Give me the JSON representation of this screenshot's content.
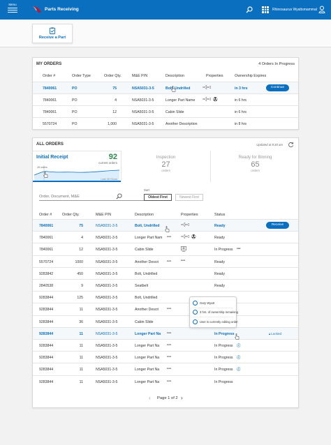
{
  "header": {
    "menu_label": "Menu",
    "app_title": "Parts Receiving",
    "user_name": "Rhinosaurus Wyattsmammal",
    "brand_color": "#0b6fbf"
  },
  "toolbar": {
    "receive_label": "Receive a Part",
    "receive_icon": "clipboard-check-icon"
  },
  "my_orders": {
    "title": "MY ORDERS",
    "count_label": "4 Orders In Progress",
    "columns": [
      "Order #",
      "Order Type",
      "Order Qty.",
      "M&E P/N",
      "Description",
      "Properties",
      "Ownership Expires"
    ],
    "rows": [
      {
        "order": "7840061",
        "type": "PO",
        "qty": "75",
        "pn": "NSA5031-3-5",
        "desc": "Bolt, Undrilled",
        "props": [
          "airplane-icon"
        ],
        "expires": "in 3 hrs",
        "action": "Continue",
        "highlight": true
      },
      {
        "order": "7840061",
        "type": "PO",
        "qty": "4",
        "pn": "NSA5031-3-5",
        "desc": "Longer Part Name",
        "props": [
          "airplane-icon",
          "radiation-icon"
        ],
        "expires": "in 6 hrs",
        "action": "",
        "highlight": false
      },
      {
        "order": "7840061",
        "type": "PO",
        "qty": "12",
        "pn": "NSA5031-3-5",
        "desc": "Cabin Slide",
        "props": [],
        "expires": "in 6 hrs",
        "action": "",
        "highlight": false
      },
      {
        "order": "5570724",
        "type": "PO",
        "qty": "1,000",
        "pn": "NSA5031-3-5",
        "desc": "Another Description",
        "props": [],
        "expires": "in 8 hrs",
        "action": "",
        "highlight": false
      }
    ]
  },
  "all_orders": {
    "title": "ALL ORDERS",
    "updated": "Updated at 8:30 am",
    "initial_receipt": {
      "label": "Initial Receipt",
      "count": "92",
      "sub": "current orders",
      "chart_note": "Last 48 Hours",
      "marker_label": "28 orders"
    },
    "inspection": {
      "label": "Inspection",
      "count": "27",
      "sub": "orders"
    },
    "binning": {
      "label": "Ready for Binning",
      "count": "65",
      "sub": "orders"
    },
    "search_placeholder": "Order, Document, M&E",
    "sort_label": "Sort",
    "sort_oldest": "Oldest First",
    "sort_newest": "Newest First",
    "columns": [
      "Order #",
      "Order Qty.",
      "M&E P/N",
      "Description",
      "Properties",
      "Status"
    ],
    "rows": [
      {
        "order": "7840061",
        "qty": "75",
        "pn": "NSA5031-3-5",
        "desc": "Bolt, Undrilled",
        "more": "",
        "props": [
          "airplane-icon"
        ],
        "status": "Ready",
        "status_more": "",
        "action": "Receive",
        "blue": true,
        "highlight": true
      },
      {
        "order": "7840061",
        "qty": "4",
        "pn": "NSA5031-3-5",
        "desc": "Longer Part Nam",
        "more": "•••",
        "props": [
          "airplane-icon",
          "radiation-icon"
        ],
        "status": "Ready",
        "status_more": "",
        "action": "",
        "blue": false,
        "highlight": false
      },
      {
        "order": "7840061",
        "qty": "12",
        "pn": "NSA5031-3-5",
        "desc": "Cabin Slide",
        "more": "",
        "props": [
          "inspection-icon"
        ],
        "status": "In Progress",
        "status_more": "•••",
        "action": "",
        "blue": false,
        "highlight": false
      },
      {
        "order": "5570724",
        "qty": "1000",
        "pn": "NSA5031-3-5",
        "desc": "Another Descri",
        "more": "•••",
        "props": [
          "dots"
        ],
        "status": "Ready",
        "status_more": "",
        "action": "",
        "blue": false,
        "highlight": false
      },
      {
        "order": "9283842",
        "qty": "450",
        "pn": "NSA5031-3-5",
        "desc": "Bolt, Undrilled",
        "more": "",
        "props": [],
        "status": "Ready",
        "status_more": "",
        "action": "",
        "blue": false,
        "highlight": false
      },
      {
        "order": "2840538",
        "qty": "9",
        "pn": "NSA5031-3-5",
        "desc": "Seatbelt",
        "more": "",
        "props": [],
        "status": "Ready",
        "status_more": "",
        "action": "",
        "blue": false,
        "highlight": false
      },
      {
        "order": "9283844",
        "qty": "125",
        "pn": "NSA5031-3-5",
        "desc": "Bolt, Undrilled",
        "more": "",
        "props": [],
        "status": "",
        "status_more": "",
        "action": "",
        "blue": false,
        "highlight": false
      },
      {
        "order": "9283844",
        "qty": "11",
        "pn": "NSA5031-3-5",
        "desc": "Another Descri",
        "more": "•••",
        "props": [],
        "status": "",
        "status_more": "",
        "action": "",
        "blue": false,
        "highlight": false
      },
      {
        "order": "9283844",
        "qty": "36",
        "pn": "NSA5031-3-5",
        "desc": "Cabin Slide",
        "more": "",
        "props": [],
        "status": "",
        "status_more": "",
        "action": "",
        "blue": false,
        "highlight": false
      },
      {
        "order": "9283844",
        "qty": "11",
        "pn": "NSA5031-3-5",
        "desc": "Longer Part Na",
        "more": "•••",
        "props": [],
        "status": "In Progress",
        "status_more": "",
        "action": "Locked",
        "blue": true,
        "highlight": true
      },
      {
        "order": "9283844",
        "qty": "11",
        "pn": "NSA5031-3-5",
        "desc": "Longer Part Na",
        "more": "•••",
        "props": [],
        "status": "In Progress",
        "status_more": "ⓘ",
        "action": "",
        "blue": false,
        "highlight": false
      },
      {
        "order": "9283844",
        "qty": "11",
        "pn": "NSA5031-3-5",
        "desc": "Longer Part Na",
        "more": "•••",
        "props": [],
        "status": "In Progress",
        "status_more": "ⓘ",
        "action": "",
        "blue": false,
        "highlight": false
      },
      {
        "order": "9283844",
        "qty": "11",
        "pn": "NSA5031-3-5",
        "desc": "Longer Part Na",
        "more": "•••",
        "props": [],
        "status": "In Progress",
        "status_more": "ⓘ",
        "action": "",
        "blue": false,
        "highlight": false
      },
      {
        "order": "9283844",
        "qty": "11",
        "pn": "NSA5031-3-5",
        "desc": "Longer Part Na",
        "more": "•••",
        "props": [],
        "status": "In Progress",
        "status_more": "",
        "action": "",
        "blue": false,
        "highlight": false
      }
    ],
    "tooltip": {
      "user": "Gary Wyatt",
      "ownership": "3 hrs. of ownership remaining",
      "editing": "User is currently editing order"
    },
    "pagination": {
      "label": "Page 1 of 2"
    }
  }
}
